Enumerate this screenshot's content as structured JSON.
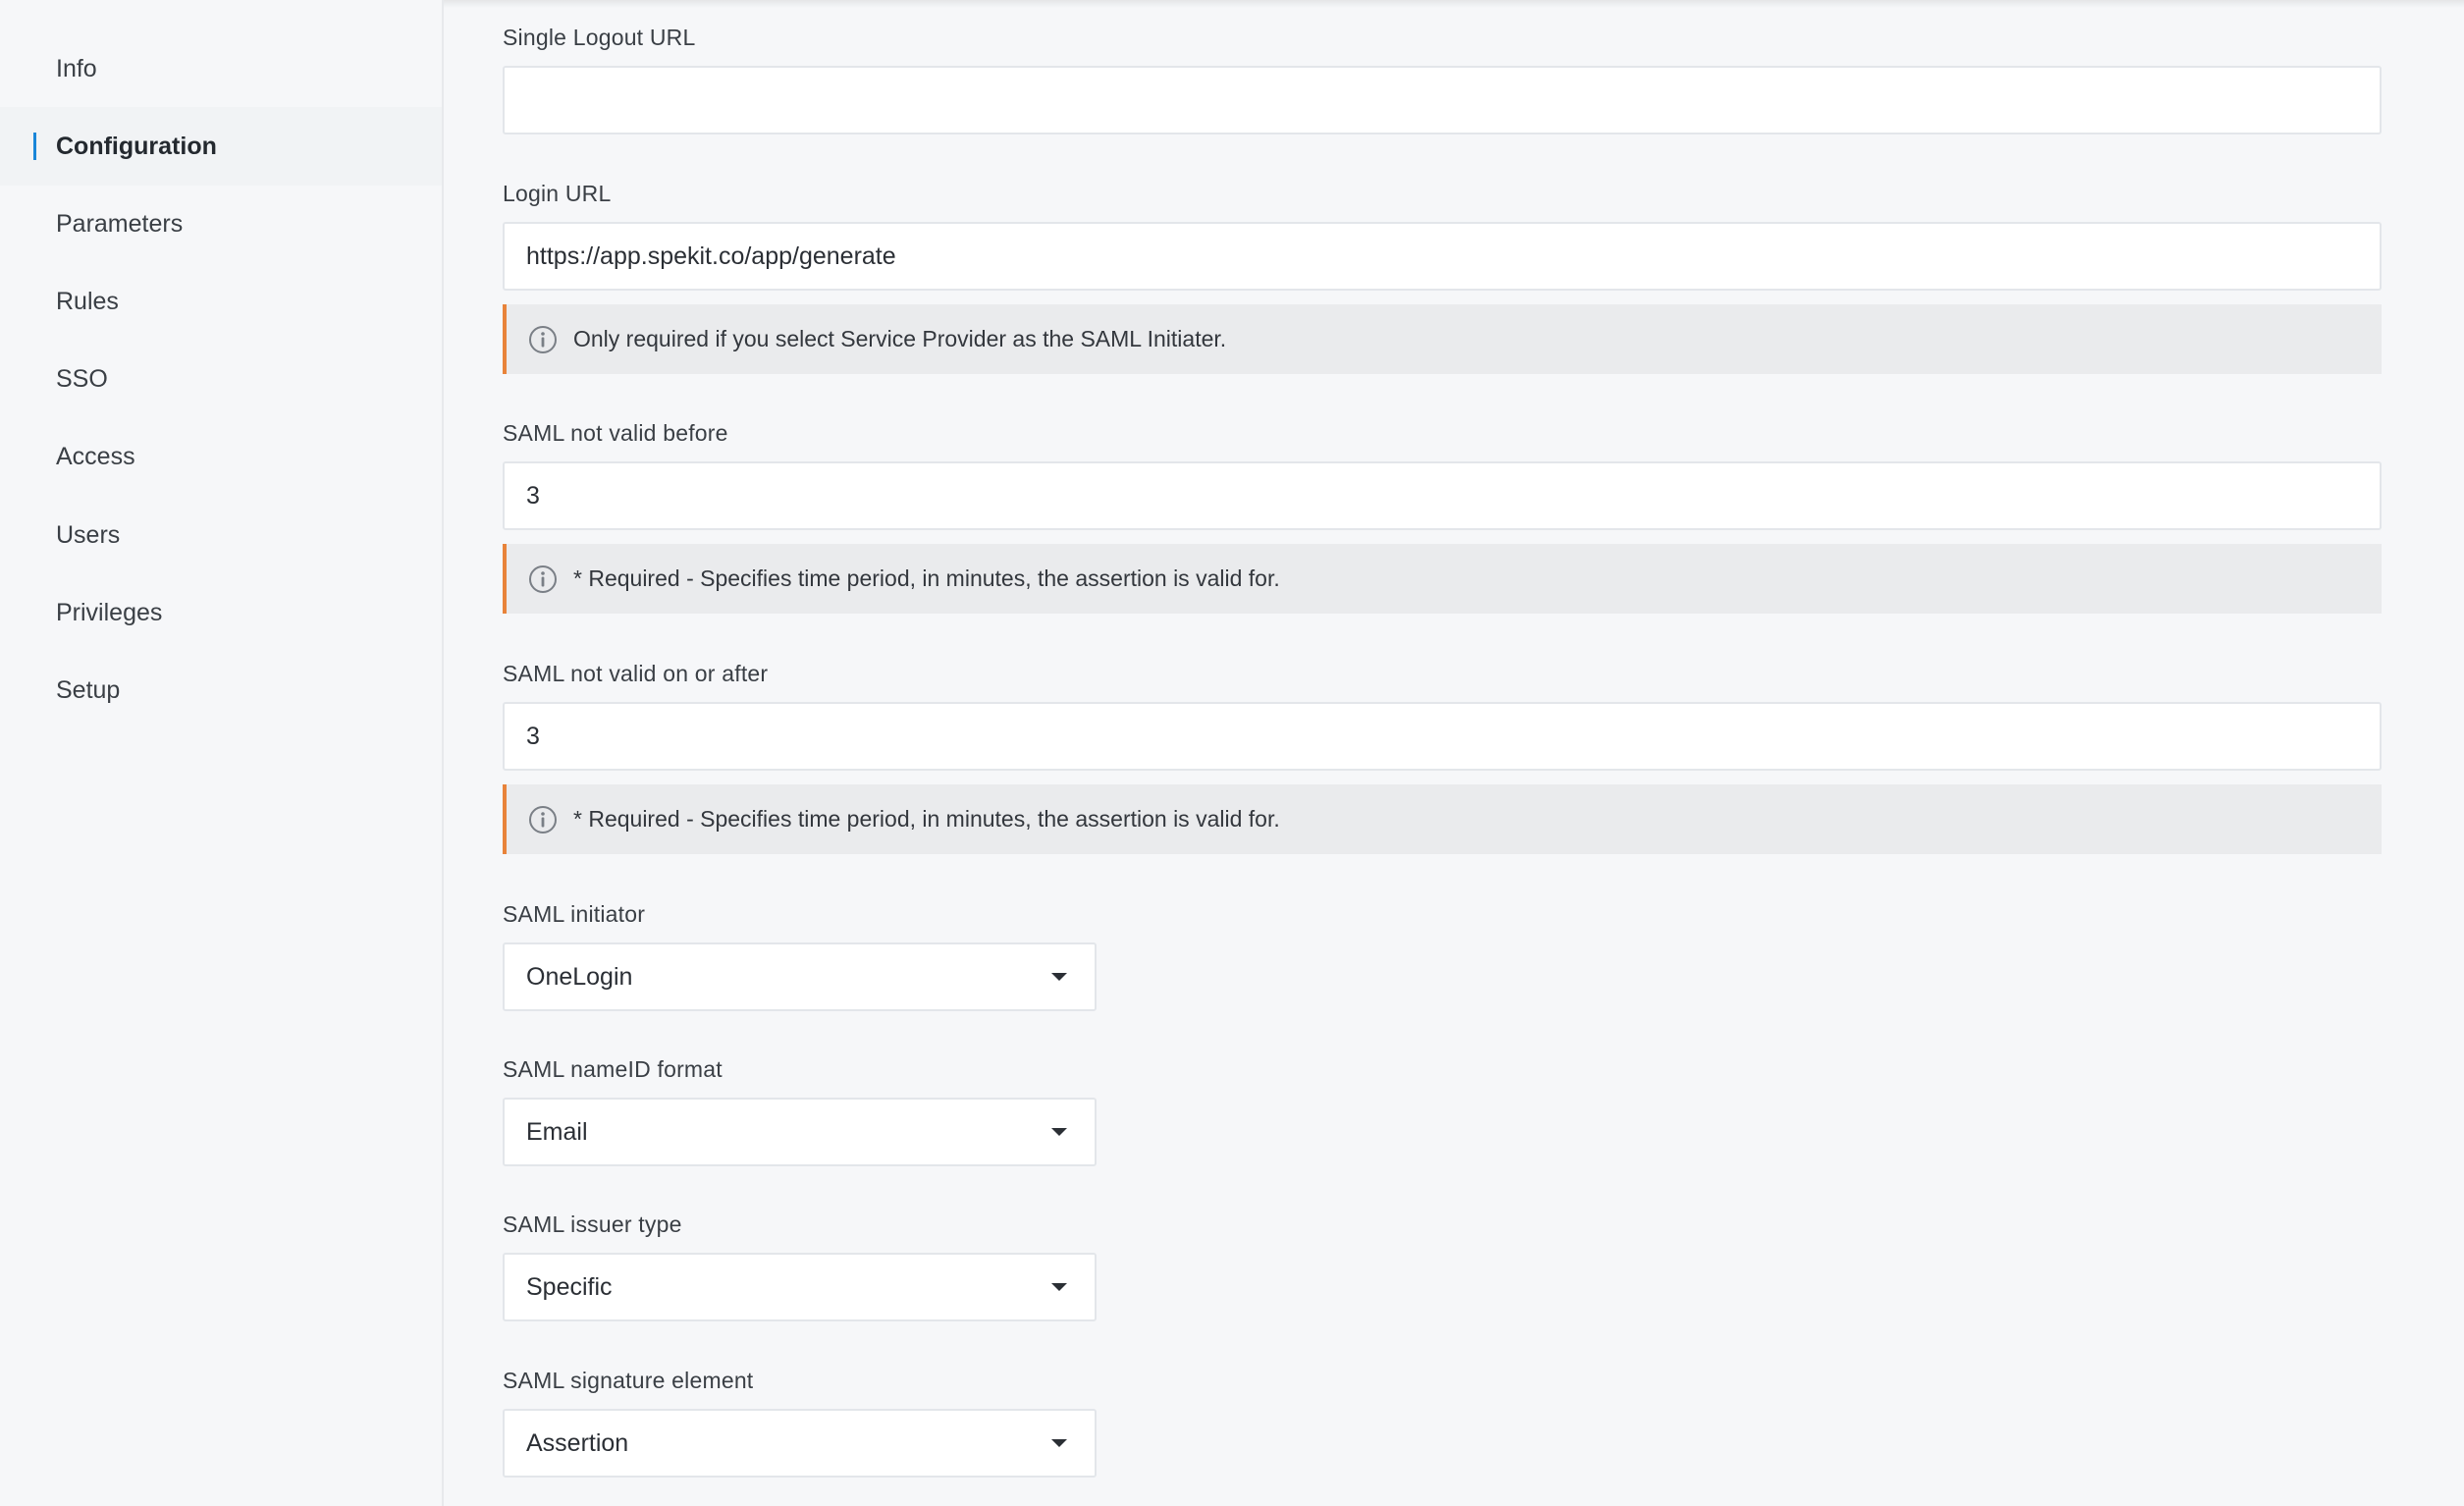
{
  "sidebar": {
    "items": [
      {
        "label": "Info"
      },
      {
        "label": "Configuration"
      },
      {
        "label": "Parameters"
      },
      {
        "label": "Rules"
      },
      {
        "label": "SSO"
      },
      {
        "label": "Access"
      },
      {
        "label": "Users"
      },
      {
        "label": "Privileges"
      },
      {
        "label": "Setup"
      }
    ],
    "active": "Configuration",
    "active_accent_color": "#1a86d8"
  },
  "form": {
    "single_logout_url": {
      "label": "Single Logout URL",
      "value": ""
    },
    "login_url": {
      "label": "Login URL",
      "value": "https://app.spekit.co/app/generate",
      "note": "Only required if you select Service Provider as the SAML Initiater."
    },
    "saml_not_valid_before": {
      "label": "SAML not valid before",
      "value": "3",
      "note": "* Required - Specifies time period, in minutes, the assertion is valid for."
    },
    "saml_not_valid_on_or_after": {
      "label": "SAML not valid on or after",
      "value": "3",
      "note": "* Required - Specifies time period, in minutes, the assertion is valid for."
    },
    "saml_initiator": {
      "label": "SAML initiator",
      "selected": "OneLogin"
    },
    "saml_nameid_format": {
      "label": "SAML nameID format",
      "selected": "Email"
    },
    "saml_issuer_type": {
      "label": "SAML issuer type",
      "selected": "Specific"
    },
    "saml_signature_element": {
      "label": "SAML signature element",
      "selected": "Assertion"
    }
  },
  "colors": {
    "note_accent": "#e8833a",
    "page_background": "#f6f7f9"
  },
  "icons": {
    "note_icon": "info-icon",
    "select_icon": "caret-down-icon"
  }
}
